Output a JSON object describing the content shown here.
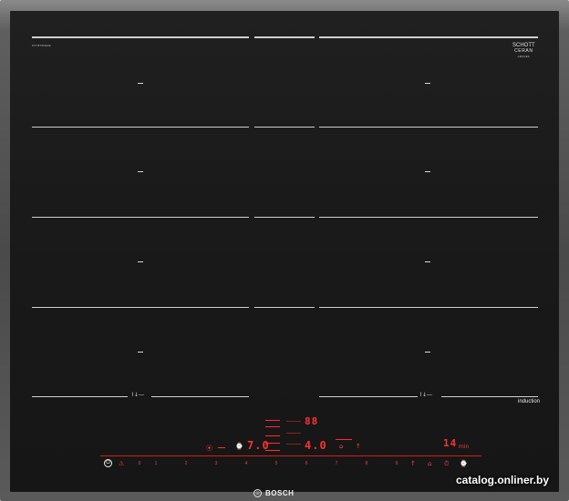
{
  "hob": {
    "model_text": "PXY875DE3E",
    "corner_mark": "SCHOTT",
    "corner_mark2": "CERAN",
    "corner_tag": "ABCDEF",
    "induction_label": "induction",
    "flex_left": "⌇↓―",
    "flex_right": "⌇↓―"
  },
  "controls": {
    "power_symbol": "⏻",
    "lock_icon": "⚠",
    "scale": [
      "0",
      "1",
      "2",
      "3",
      "4",
      "5",
      "6",
      "7",
      "8",
      "9"
    ],
    "boost_icon": "↑",
    "pan_icon": "⌂",
    "timer_icon": "⏱",
    "clock_icon": "⌚"
  },
  "display": {
    "top_value": "88",
    "left_value": "7.0",
    "middle_value": "4.0",
    "right_value": "14",
    "right_unit": "min",
    "timer_left_icon": "⌚",
    "sensor_icon": "⦿"
  },
  "brand": {
    "logo": "◎",
    "name": "BOSCH"
  },
  "watermark": "catalog.onliner.by"
}
